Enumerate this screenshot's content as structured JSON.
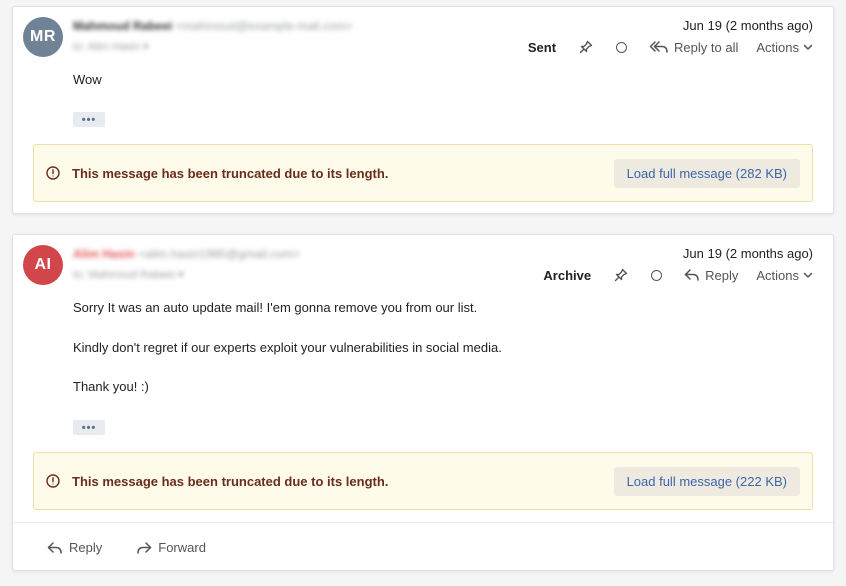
{
  "messages": [
    {
      "avatar_initials": "MR",
      "avatar_color": "#6f8296",
      "sender_name": "Mahmoud Rabeei",
      "sender_email": "<mahmoud@example-mail.com>",
      "recipient": "to: Alim Hasin",
      "date": "Jun 19 (2 months ago)",
      "folder": "Sent",
      "reply_label": "Reply to all",
      "actions_label": "Actions",
      "body": [
        "Wow"
      ],
      "notice_text": "This message has been truncated due to its length.",
      "load_label": "Load full message (282 KB)"
    },
    {
      "avatar_initials": "AI",
      "avatar_color": "#d0464a",
      "sender_name": "Alim Hasin",
      "sender_email": "<alim.hasin1985@gmail.com>",
      "recipient": "to: Mahmoud Rabeei",
      "date": "Jun 19 (2 months ago)",
      "folder": "Archive",
      "reply_label": "Reply",
      "actions_label": "Actions",
      "body": [
        "Sorry It was an auto update mail! I'em gonna remove you from our list.",
        "Kindly don't regret if our experts exploit your vulnerabilities in social media.",
        "Thank you! :)"
      ],
      "notice_text": "This message has been truncated due to its length.",
      "load_label": "Load full message (222 KB)"
    }
  ],
  "footer": {
    "reply_label": "Reply",
    "forward_label": "Forward"
  },
  "icons": {
    "pin": "pin-icon",
    "unread": "unread-circle-icon",
    "reply": "reply-icon",
    "reply_all": "reply-all-icon",
    "forward": "forward-icon",
    "chevron": "chevron-down-icon",
    "warning": "warning-circle-icon"
  }
}
